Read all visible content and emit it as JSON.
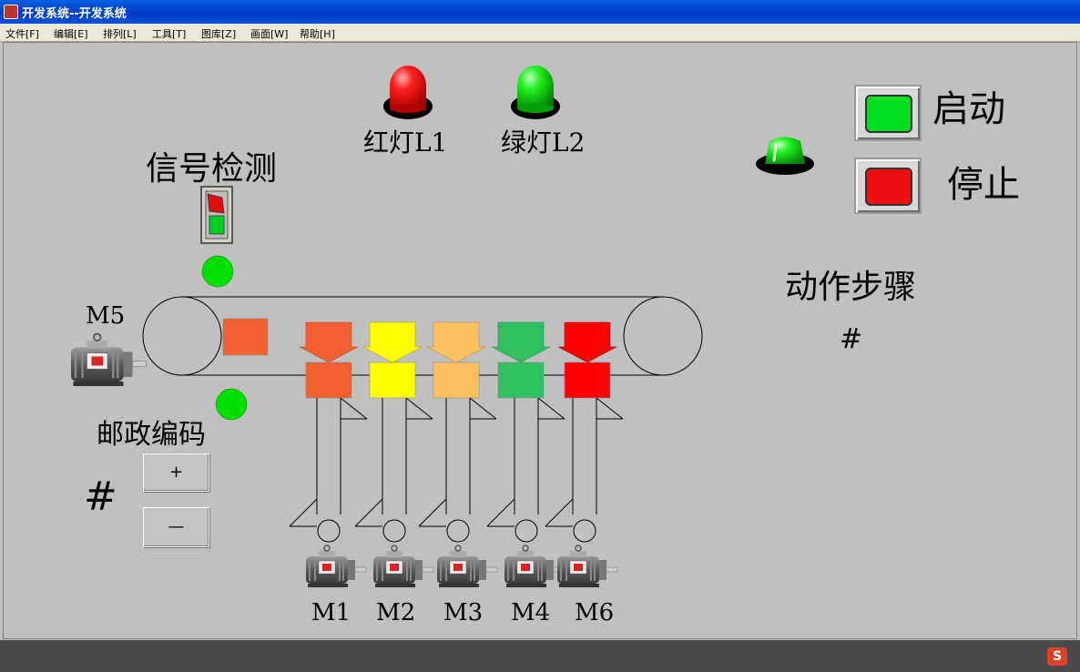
{
  "window": {
    "title": "开发系统--开发系统"
  },
  "menu": [
    "文件[F]",
    "编辑[E]",
    "排列[L]",
    "工具[T]",
    "图库[Z]",
    "画面[W]",
    "帮助[H]"
  ],
  "labels": {
    "signal_detect": "信号检测",
    "postal_code": "邮政编码",
    "action_step": "动作步骤",
    "start": "启动",
    "stop": "停止",
    "red_lamp": "红灯L1",
    "green_lamp": "绿灯L2",
    "postal_value": "#",
    "step_value": "#"
  },
  "buttons": {
    "plus": "+",
    "minus": "—"
  },
  "motors": {
    "m5": "M5",
    "m1": "M1",
    "m2": "M2",
    "m3": "M3",
    "m4": "M4",
    "m6": "M6"
  },
  "colors": {
    "lamp_red": "#ff1010",
    "lamp_green": "#10e010",
    "start_face": "#00e020",
    "stop_face": "#ee1010",
    "sensor_green": "#00e000",
    "box_orange": "#f06030",
    "chute_colors": [
      "#f06030",
      "#ffff00",
      "#ffc060",
      "#30c060",
      "#ff0000"
    ]
  }
}
